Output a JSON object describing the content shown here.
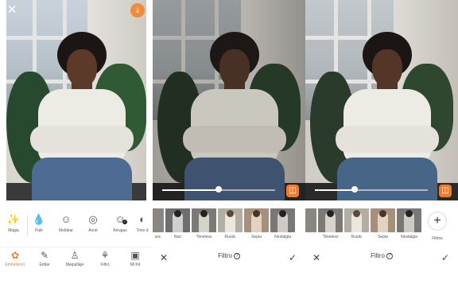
{
  "colors": {
    "accent": "#f07b2c",
    "text": "#555555"
  },
  "panel1": {
    "close_icon": "✕",
    "download_icon": "⤓",
    "tools": [
      {
        "icon": "magic-wand-icon",
        "glyph": "✨",
        "label": "Magia"
      },
      {
        "icon": "drop-icon",
        "glyph": "💧",
        "label": "Pulir"
      },
      {
        "icon": "smile-icon",
        "glyph": "☺",
        "label": "Moldear"
      },
      {
        "icon": "aperture-icon",
        "glyph": "◎",
        "label": "Acné"
      },
      {
        "icon": "face-icon",
        "glyph": "☺",
        "label": "Arrugas"
      },
      {
        "icon": "tone-icon",
        "glyph": "◐",
        "label": "Tono d"
      }
    ],
    "nav": [
      {
        "icon": "retouch-icon",
        "glyph": "✿",
        "label": "Embellecer",
        "active": true
      },
      {
        "icon": "edit-icon",
        "glyph": "✎",
        "label": "Editar",
        "active": false
      },
      {
        "icon": "makeup-icon",
        "glyph": "♙",
        "label": "Maquillaje",
        "active": false
      },
      {
        "icon": "filters-icon",
        "glyph": "⚘",
        "label": "Filtro",
        "active": false
      },
      {
        "icon": "mykit-icon",
        "glyph": "▣",
        "label": "Mi Kit",
        "active": false
      }
    ]
  },
  "panel2": {
    "slider_value": 0.5,
    "filters": [
      "soc",
      "Noir",
      "Timeless",
      "Rustic",
      "Sepia",
      "Nostalgia"
    ],
    "title": "Filtro",
    "help": "?"
  },
  "panel3": {
    "slider_value": 0.35,
    "filters": [
      "",
      "Timeless",
      "Rustic",
      "Sepia",
      "Nostalgia"
    ],
    "add_label": "Filtros",
    "add_glyph": "+",
    "title": "Filtro",
    "help": "?"
  }
}
